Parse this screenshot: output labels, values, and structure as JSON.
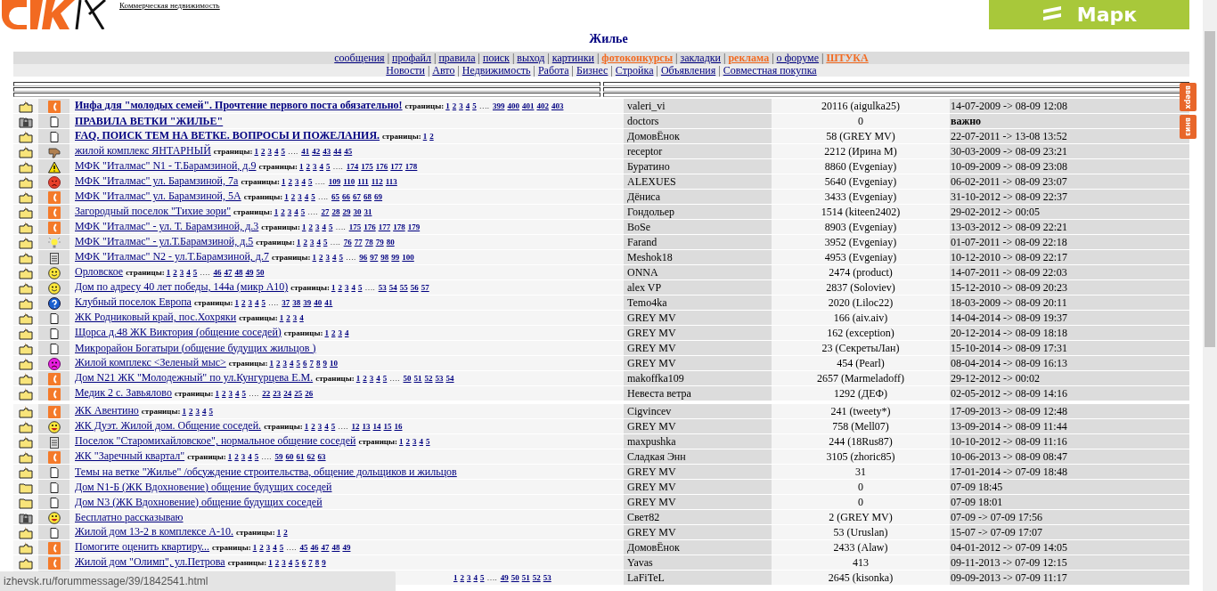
{
  "header": {
    "sub_link": "Коммерческая недвижимость",
    "banner_text": "Марк"
  },
  "title": "Жилье",
  "nav": {
    "separator": "|",
    "main": [
      {
        "label": "сообщения",
        "accent": false
      },
      {
        "label": "профайл",
        "accent": false
      },
      {
        "label": "правила",
        "accent": false
      },
      {
        "label": "поиск",
        "accent": false
      },
      {
        "label": "выход",
        "accent": false
      },
      {
        "label": "картинки",
        "accent": false
      },
      {
        "label": "фотоконкурсы",
        "accent": true
      },
      {
        "label": "закладки",
        "accent": false
      },
      {
        "label": "реклама",
        "accent": true
      },
      {
        "label": "о форуме",
        "accent": false
      },
      {
        "label": "ШТУКА",
        "accent": true
      }
    ],
    "sections": [
      {
        "label": "Новости",
        "accent": false
      },
      {
        "label": "Авто",
        "accent": false
      },
      {
        "label": "Недвижимость",
        "accent": false
      },
      {
        "label": "Работа",
        "accent": false
      },
      {
        "label": "Бизнес",
        "accent": false
      },
      {
        "label": "Стройка",
        "accent": false
      },
      {
        "label": "Объявления",
        "accent": false
      },
      {
        "label": "Совместная покупка",
        "accent": false
      }
    ]
  },
  "scroll_buttons": {
    "up": "вверх",
    "down": "вниз"
  },
  "row_groups": [
    [
      {
        "new": true,
        "locked": false,
        "kind": "phone",
        "title": "Инфа для \"молодых семей\". Прочтение первого поста обязательно!",
        "bold": true,
        "important": false,
        "pages": {
          "label": "страницы:",
          "first": [
            "1",
            "2",
            "3",
            "4",
            "5"
          ],
          "gap": "….",
          "last": [
            "399",
            "400",
            "401",
            "402",
            "403"
          ]
        },
        "author": "valeri_vi",
        "replies": "20116 (aigulka25)",
        "date": "14-07-2009 -> 08-09 12:08"
      },
      {
        "new": false,
        "locked": true,
        "kind": "doc",
        "title": "ПРАВИЛА ВЕТКИ \"ЖИЛЬЕ\"",
        "bold": true,
        "important": true,
        "author": "doctors",
        "replies": "0",
        "date": "важно"
      },
      {
        "new": true,
        "locked": false,
        "kind": "doc",
        "title": "FAQ. ПОИСК ТЕМ НА ВЕТКЕ. ВОПРОСЫ И ПОЖЕЛАНИЯ.",
        "bold": true,
        "important": false,
        "pages": {
          "label": "страницы:",
          "first": [
            "1",
            "2"
          ]
        },
        "author": "ДомовЁнок",
        "replies": "58 (GREY MV)",
        "date": "22-07-2011 -> 13-08 13:52"
      },
      {
        "new": true,
        "locked": false,
        "kind": "thumb",
        "title": "жилой комплекс ЯНТАРНЫЙ",
        "bold": false,
        "important": false,
        "pages": {
          "label": "страницы:",
          "first": [
            "1",
            "2",
            "3",
            "4",
            "5"
          ],
          "gap": "….",
          "last": [
            "41",
            "42",
            "43",
            "44",
            "45"
          ]
        },
        "author": "receptor",
        "replies": "2212 (Ирина М)",
        "date": "30-03-2009 -> 08-09 23:21"
      },
      {
        "new": true,
        "locked": false,
        "kind": "warning",
        "title": "МФК \"Италмас\" N1 - Т.Барамзиной, д.9",
        "bold": false,
        "important": false,
        "pages": {
          "label": "страницы:",
          "first": [
            "1",
            "2",
            "3",
            "4",
            "5"
          ],
          "gap": "….",
          "last": [
            "174",
            "175",
            "176",
            "177",
            "178"
          ]
        },
        "author": "Буратино",
        "replies": "8860 (Evgeniay)",
        "date": "10-09-2009 -> 08-09 23:08"
      },
      {
        "new": true,
        "locked": false,
        "kind": "angry",
        "title": "МФК \"Италмас\" ул. Барамзиной, 7а",
        "bold": false,
        "important": false,
        "pages": {
          "label": "страницы:",
          "first": [
            "1",
            "2",
            "3",
            "4",
            "5"
          ],
          "gap": "….",
          "last": [
            "109",
            "110",
            "111",
            "112",
            "113"
          ]
        },
        "author": "ALEXUES",
        "replies": "5640 (Evgeniay)",
        "date": "06-02-2011 -> 08-09 23:07"
      },
      {
        "new": true,
        "locked": false,
        "kind": "phone",
        "title": "МФК \"Италмас\" ул. Барамзиной, 5А",
        "bold": false,
        "important": false,
        "pages": {
          "label": "страницы:",
          "first": [
            "1",
            "2",
            "3",
            "4",
            "5"
          ],
          "gap": "….",
          "last": [
            "65",
            "66",
            "67",
            "68",
            "69"
          ]
        },
        "author": "Дёниса",
        "replies": "3433 (Evgeniay)",
        "date": "31-10-2012 -> 08-09 22:37"
      },
      {
        "new": true,
        "locked": false,
        "kind": "phone",
        "title": "Загородный поселок \"Тихие зори\"",
        "bold": false,
        "important": false,
        "pages": {
          "label": "страницы:",
          "first": [
            "1",
            "2",
            "3",
            "4",
            "5"
          ],
          "gap": "….",
          "last": [
            "27",
            "28",
            "29",
            "30",
            "31"
          ]
        },
        "author": "Гондольер",
        "replies": "1514 (kiteen2402)",
        "date": "29-02-2012 -> 00:05"
      },
      {
        "new": true,
        "locked": false,
        "kind": "phone",
        "title": "МФК \"Италмас\" - ул. Т. Барамзиной, д.3",
        "bold": false,
        "important": false,
        "pages": {
          "label": "страницы:",
          "first": [
            "1",
            "2",
            "3",
            "4",
            "5"
          ],
          "gap": "….",
          "last": [
            "175",
            "176",
            "177",
            "178",
            "179"
          ]
        },
        "author": "BoSe",
        "replies": "8903 (Evgeniay)",
        "date": "13-03-2012 -> 08-09 22:21"
      },
      {
        "new": true,
        "locked": false,
        "kind": "bulb",
        "title": "МФК \"Италмас\" - ул.Т.Барамзиной, д.5",
        "bold": false,
        "important": false,
        "pages": {
          "label": "страницы:",
          "first": [
            "1",
            "2",
            "3",
            "4",
            "5"
          ],
          "gap": "….",
          "last": [
            "76",
            "77",
            "78",
            "79",
            "80"
          ]
        },
        "author": "Farand",
        "replies": "3952 (Evgeniay)",
        "date": "01-07-2011 -> 08-09 22:18"
      },
      {
        "new": true,
        "locked": false,
        "kind": "clipboard",
        "title": "МФК \"Италмас\" N2 - ул.Т.Барамзиной, д.7",
        "bold": false,
        "important": false,
        "pages": {
          "label": "страницы:",
          "first": [
            "1",
            "2",
            "3",
            "4",
            "5"
          ],
          "gap": "….",
          "last": [
            "96",
            "97",
            "98",
            "99",
            "100"
          ]
        },
        "author": "Meshok18",
        "replies": "4953 (Evgeniay)",
        "date": "10-12-2010 -> 08-09 22:17"
      },
      {
        "new": true,
        "locked": false,
        "kind": "smile",
        "title": "Орловское",
        "bold": false,
        "important": false,
        "pages": {
          "label": "страницы:",
          "first": [
            "1",
            "2",
            "3",
            "4",
            "5"
          ],
          "gap": "….",
          "last": [
            "46",
            "47",
            "48",
            "49",
            "50"
          ]
        },
        "author": "ONNA",
        "replies": "2474 (product)",
        "date": "14-07-2011 -> 08-09 22:03"
      },
      {
        "new": true,
        "locked": false,
        "kind": "smile",
        "title": "Дом по адресу 40 лет победы, 144а (микр А10)",
        "bold": false,
        "important": false,
        "pages": {
          "label": "страницы:",
          "first": [
            "1",
            "2",
            "3",
            "4",
            "5"
          ],
          "gap": "….",
          "last": [
            "53",
            "54",
            "55",
            "56",
            "57"
          ]
        },
        "author": "alex VP",
        "replies": "2837 (Soloviev)",
        "date": "15-12-2010 -> 08-09 20:23"
      },
      {
        "new": true,
        "locked": false,
        "kind": "question",
        "title": "Клубный поселок Европа",
        "bold": false,
        "important": false,
        "pages": {
          "label": "страницы:",
          "first": [
            "1",
            "2",
            "3",
            "4",
            "5"
          ],
          "gap": "….",
          "last": [
            "37",
            "38",
            "39",
            "40",
            "41"
          ]
        },
        "author": "Temo4ka",
        "replies": "2020 (Liloc22)",
        "date": "18-03-2009 -> 08-09 20:11"
      },
      {
        "new": true,
        "locked": false,
        "kind": "doc",
        "title": "ЖК Родниковый край, пос.Хохряки",
        "bold": false,
        "important": false,
        "pages": {
          "label": "страницы:",
          "first": [
            "1",
            "2",
            "3",
            "4"
          ]
        },
        "author": "GREY MV",
        "replies": "166 (aiv.aiv)",
        "date": "14-04-2014 -> 08-09 19:37"
      },
      {
        "new": true,
        "locked": false,
        "kind": "doc",
        "title": "Щорса д.48 ЖК Виктория (общение соседей)",
        "bold": false,
        "important": false,
        "pages": {
          "label": "страницы:",
          "first": [
            "1",
            "2",
            "3",
            "4"
          ]
        },
        "author": "GREY MV",
        "replies": "162 (exception)",
        "date": "20-12-2014 -> 08-09 18:18"
      },
      {
        "new": true,
        "locked": false,
        "kind": "doc",
        "title": "Микрорайон Богатыри (общение будущих жильцов )",
        "bold": false,
        "important": false,
        "author": "GREY MV",
        "replies": "23 (СекретыЛан)",
        "date": "15-10-2014 -> 08-09 17:31"
      },
      {
        "new": true,
        "locked": false,
        "kind": "sad",
        "title": "Жилой комплекс <Зеленый мыс>",
        "bold": false,
        "important": false,
        "pages": {
          "label": "страницы:",
          "first": [
            "1",
            "2",
            "3",
            "4",
            "5",
            "6",
            "7",
            "8",
            "9",
            "10"
          ]
        },
        "author": "GREY MV",
        "replies": "454 (Pearl)",
        "date": "08-04-2014 -> 08-09 16:13"
      },
      {
        "new": true,
        "locked": false,
        "kind": "phone",
        "title": "Дом N21 ЖК \"Молодежный\" по ул.Кунгурцева Е.М.",
        "bold": false,
        "important": false,
        "pages": {
          "label": "страницы:",
          "first": [
            "1",
            "2",
            "3",
            "4",
            "5"
          ],
          "gap": "….",
          "last": [
            "50",
            "51",
            "52",
            "53",
            "54"
          ]
        },
        "author": "makoffka109",
        "replies": "2657 (Marmeladoff)",
        "date": "29-12-2012 -> 00:02"
      },
      {
        "new": true,
        "locked": false,
        "kind": "phone",
        "title": "Медик 2 с. Завьялово",
        "bold": false,
        "important": false,
        "pages": {
          "label": "страницы:",
          "first": [
            "1",
            "2",
            "3",
            "4",
            "5"
          ],
          "gap": "….",
          "last": [
            "22",
            "23",
            "24",
            "25",
            "26"
          ]
        },
        "author": "Невеста ветра",
        "replies": "1292 (ДЕФ)",
        "date": "02-05-2012 -> 08-09 14:16"
      }
    ],
    [
      {
        "new": true,
        "locked": false,
        "kind": "phone",
        "title": "ЖК Авентино",
        "bold": false,
        "important": false,
        "pages": {
          "label": "страницы:",
          "first": [
            "1",
            "2",
            "3",
            "4",
            "5"
          ]
        },
        "author": "Cigvincev",
        "replies": "241 (tweety*)",
        "date": "17-09-2013 -> 08-09 12:48"
      },
      {
        "new": true,
        "locked": false,
        "kind": "grin",
        "title": "ЖК Дуэт. Жилой дом. Общение соседей.",
        "bold": false,
        "important": false,
        "pages": {
          "label": "страницы:",
          "first": [
            "1",
            "2",
            "3",
            "4",
            "5"
          ],
          "gap": "….",
          "last": [
            "12",
            "13",
            "14",
            "15",
            "16"
          ]
        },
        "author": "GREY MV",
        "replies": "758 (Mell07)",
        "date": "13-09-2014 -> 08-09 11:44"
      },
      {
        "new": true,
        "locked": false,
        "kind": "clipboard",
        "title": "Поселок \"Старомихайловское\", нормальное общение соседей",
        "bold": false,
        "important": false,
        "pages": {
          "label": "страницы:",
          "first": [
            "1",
            "2",
            "3",
            "4",
            "5"
          ]
        },
        "author": "maxpushka",
        "replies": "244 (18Rus87)",
        "date": "10-10-2012 -> 08-09 11:16"
      },
      {
        "new": true,
        "locked": false,
        "kind": "phone",
        "title": "ЖК \"Заречный квартал\"",
        "bold": false,
        "important": false,
        "pages": {
          "label": "страницы:",
          "first": [
            "1",
            "2",
            "3",
            "4",
            "5"
          ],
          "gap": "….",
          "last": [
            "59",
            "60",
            "61",
            "62",
            "63"
          ]
        },
        "author": "Сладкая Энн",
        "replies": "3105 (zhoric85)",
        "date": "10-06-2013 -> 08-09 08:47"
      },
      {
        "new": true,
        "locked": false,
        "kind": "doc",
        "title": "Темы на ветке \"Жилье\" /обсуждение строительства, общение дольщиков и жильцов",
        "bold": false,
        "important": false,
        "author": "GREY MV",
        "replies": "31",
        "date": "17-01-2014 -> 07-09 18:48"
      },
      {
        "new": false,
        "locked": false,
        "kind": "doc",
        "title": "Дом N1-Б (ЖК Вдохновение) общение будущих соседей",
        "bold": false,
        "important": false,
        "author": "GREY MV",
        "replies": "0",
        "date": "07-09 18:45"
      },
      {
        "new": false,
        "locked": false,
        "kind": "doc",
        "title": "Дом N3 (ЖК Вдохновение) общение будущих соседей",
        "bold": false,
        "important": false,
        "author": "GREY MV",
        "replies": "0",
        "date": "07-09 18:01"
      },
      {
        "new": false,
        "locked": true,
        "kind": "grin",
        "title": "Бесплатно рассказываю",
        "bold": false,
        "important": false,
        "author": "Свет82",
        "replies": "2 (GREY MV)",
        "date": "07-09 -> 07-09 17:56"
      },
      {
        "new": true,
        "locked": false,
        "kind": "doc",
        "title": "Жилой дом 13-2 в комплексе А-10.",
        "bold": false,
        "important": false,
        "pages": {
          "label": "страницы:",
          "first": [
            "1",
            "2"
          ]
        },
        "author": "GREY MV",
        "replies": "53 (Uruslan)",
        "date": "15-07 -> 07-09 17:07"
      },
      {
        "new": true,
        "locked": false,
        "kind": "phone",
        "title": "Помогите оценить квартиру...",
        "bold": false,
        "important": false,
        "pages": {
          "label": "страницы:",
          "first": [
            "1",
            "2",
            "3",
            "4",
            "5"
          ],
          "gap": "….",
          "last": [
            "45",
            "46",
            "47",
            "48",
            "49"
          ]
        },
        "author": "ДомовЁнок",
        "replies": "2433 (Alaw)",
        "date": "04-01-2012 -> 07-09 14:05"
      },
      {
        "new": true,
        "locked": false,
        "kind": "phone",
        "title": "Жилой дом \"Олимп\", ул.Петрова",
        "bold": false,
        "important": false,
        "pages": {
          "label": "страницы:",
          "first": [
            "1",
            "2",
            "3",
            "4",
            "5",
            "6",
            "7",
            "8",
            "9"
          ]
        },
        "author": "Yavas",
        "replies": "413",
        "date": "09-11-2013 -> 07-09 12:15"
      },
      {
        "important": false,
        "pages": {
          "first": [
            "1",
            "2",
            "3",
            "4",
            "5"
          ],
          "gap": "….",
          "last": [
            "49",
            "50",
            "51",
            "52",
            "53"
          ]
        },
        "author": "LaFiTeL",
        "replies": "2645 (kisonka)",
        "date": "09-09-2013 -> 07-09 11:17"
      }
    ]
  ],
  "status_bar": "izhevsk.ru/forummessage/39/1842541.html"
}
